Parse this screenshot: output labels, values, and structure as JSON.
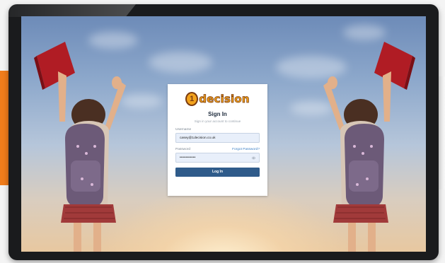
{
  "login": {
    "logo_mark": "1",
    "logo_word": "decision",
    "title": "Sign In",
    "subtitle": "Sign in your account to continue",
    "username_label": "Username",
    "username_value": "casey@1decision.co.uk",
    "password_label": "Password",
    "forgot_link": "Forgot Password?",
    "password_value": "•••••••••••",
    "login_button": "Log In"
  },
  "colors": {
    "accent_orange": "#f07c1b",
    "logo_orange": "#f2a21c",
    "button_blue": "#2f5b8a",
    "link_blue": "#3b7fc4",
    "input_bg": "#e8effa"
  },
  "icons": [
    "eye-icon",
    "book-icon"
  ]
}
